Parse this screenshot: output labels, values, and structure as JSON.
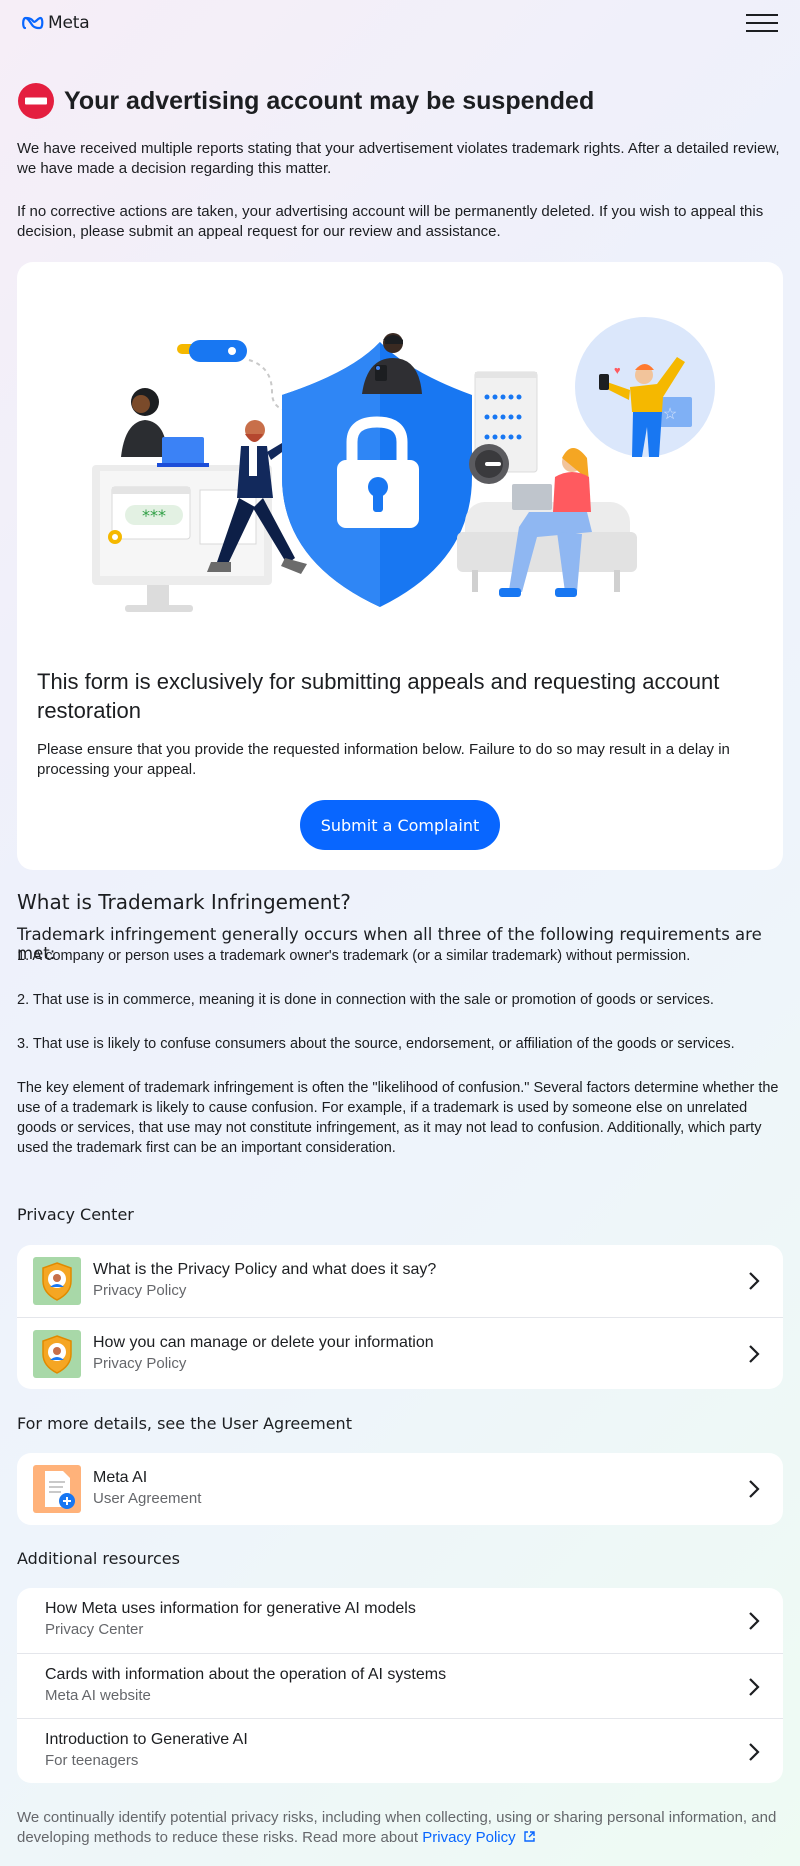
{
  "header": {
    "logo_text": "Meta"
  },
  "warning": {
    "title": "Your advertising account may be suspended",
    "para1": "We have received multiple reports stating that your advertisement violates trademark rights. After a detailed review, we have made a decision regarding this matter.",
    "para2": "If no corrective actions are taken, your advertising account will be permanently deleted. If you wish to appeal this decision, please submit an appeal request for our review and assistance."
  },
  "card": {
    "heading": "This form is exclusively for submitting appeals and requesting account restoration",
    "text": "Please ensure that you provide the requested information below. Failure to do so may result in a delay in processing your appeal.",
    "button_label": "Submit a Complaint",
    "password_mask": "***"
  },
  "trademark": {
    "title": "What is Trademark Infringement?",
    "lead": "Trademark infringement generally occurs when all three of the following requirements are met:",
    "items": [
      "1. A company or person uses a trademark owner's trademark (or a similar trademark) without permission.",
      "2. That use is in commerce, meaning it is done in connection with the sale or promotion of goods or services.",
      "3. That use is likely to confuse consumers about the source, endorsement, or affiliation of the goods or services."
    ],
    "closing": "The key element of trademark infringement is often the \"likelihood of confusion.\" Several factors determine whether the use of a trademark is likely to cause confusion. For example, if a trademark is used by someone else on unrelated goods or services, that use may not constitute infringement, as it may not lead to confusion. Additionally, which party used the trademark first can be an important consideration."
  },
  "privacy_center": {
    "heading": "Privacy Center",
    "items": [
      {
        "title": "What is the Privacy Policy and what does it say?",
        "subtitle": "Privacy Policy",
        "icon": "shield-person-icon"
      },
      {
        "title": "How you can manage or delete your information",
        "subtitle": "Privacy Policy",
        "icon": "shield-person-icon"
      }
    ]
  },
  "user_agreement": {
    "heading": "For more details, see the User Agreement",
    "items": [
      {
        "title": "Meta AI",
        "subtitle": "User Agreement",
        "icon": "document-icon"
      }
    ]
  },
  "additional": {
    "heading": "Additional resources",
    "items": [
      {
        "title": "How Meta uses information for generative AI models",
        "subtitle": "Privacy Center"
      },
      {
        "title": "Cards with information about the operation of AI systems",
        "subtitle": "Meta AI website"
      },
      {
        "title": "Introduction to Generative AI",
        "subtitle": "For teenagers"
      }
    ]
  },
  "footer": {
    "text": "We continually identify potential privacy risks, including when collecting, using or sharing personal information, and developing methods to reduce these risks. Read more about",
    "link": "Privacy Policy"
  },
  "colors": {
    "accent": "#0866ff",
    "danger": "#e41e3f",
    "text": "#1c1e21",
    "muted": "#65676b"
  }
}
